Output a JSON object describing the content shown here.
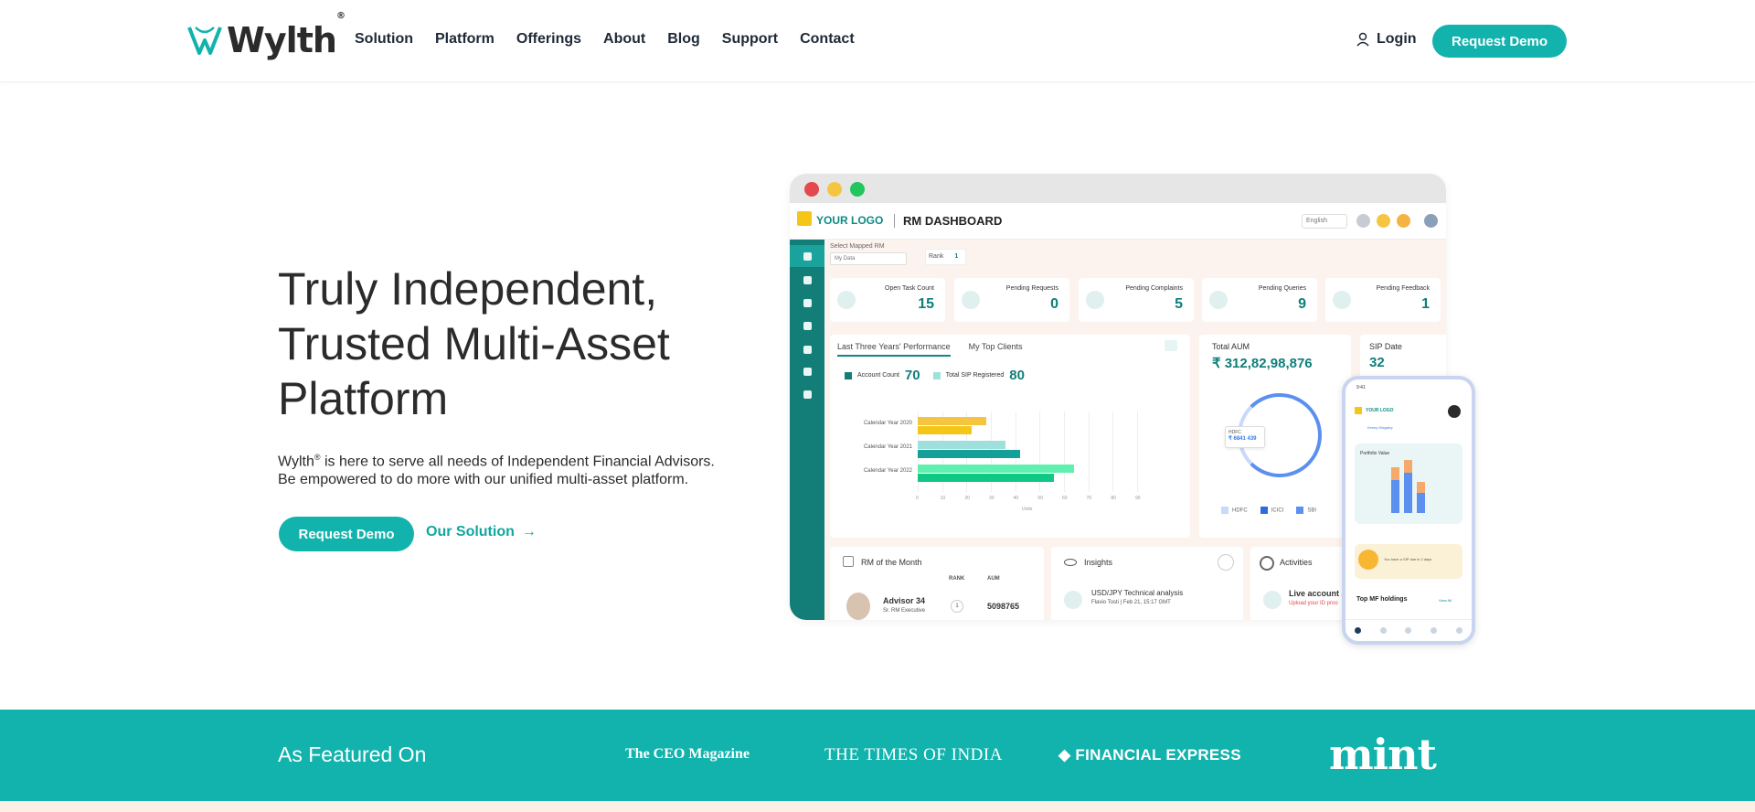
{
  "header": {
    "brand": "Wylth",
    "brand_reg": "®",
    "nav": [
      "Solution",
      "Platform",
      "Offerings",
      "About",
      "Blog",
      "Support",
      "Contact"
    ],
    "login_label": "Login",
    "login_icon": "user-icon",
    "demo_label": "Request Demo"
  },
  "hero": {
    "title_line1": "Truly Independent,",
    "title_line2": "Trusted Multi-Asset",
    "title_line3": "Platform",
    "sub_brand": "Wylth",
    "sub_reg": "®",
    "sub_line1_rest": " is here to serve all needs of Independent Financial Advisors.",
    "sub_line2": "Be empowered to do more with our unified multi-asset platform.",
    "demo_label": "Request Demo",
    "solution_label": "Our Solution",
    "solution_arrow": "→"
  },
  "dashboard": {
    "logo_text": "YOUR LOGO",
    "title": "RM DASHBOARD",
    "language": "English",
    "select_label": "Select Mapped RM",
    "select_value": "My Data",
    "rank_label": "Rank",
    "rank_value": "1",
    "kpis": [
      {
        "label": "Open Task Count",
        "value": "15"
      },
      {
        "label": "Pending Requests",
        "value": "0"
      },
      {
        "label": "Pending Complaints",
        "value": "5"
      },
      {
        "label": "Pending Queries",
        "value": "9"
      },
      {
        "label": "Pending Feedback",
        "value": "1"
      }
    ],
    "perf_tabs": [
      "Last Three Years' Performance",
      "My Top Clients"
    ],
    "account_count_label": "Account Count",
    "account_count_value": "70",
    "sip_registered_label": "Total SIP Registered",
    "sip_registered_value": "80",
    "chart_data": {
      "type": "bar",
      "orientation": "horizontal",
      "categories": [
        "Calendar Year 2020",
        "Calendar Year 2021",
        "Calendar Year 2022"
      ],
      "series": [
        {
          "name": "Account Count",
          "values": [
            28,
            36,
            64
          ],
          "color": "#f5c518"
        },
        {
          "name": "Total SIP Registered",
          "values": [
            22,
            42,
            56
          ],
          "color": "#f5c518"
        }
      ],
      "series_colors": [
        [
          "#f5c542",
          "#f5c518"
        ],
        [
          "#9fe0dc",
          "#14a098"
        ],
        [
          "#5ff0b0",
          "#10c784"
        ]
      ],
      "xticks": [
        "0",
        "10",
        "20",
        "30",
        "40",
        "50",
        "60",
        "70",
        "80",
        "90"
      ],
      "xlabel": "Units",
      "xlim": [
        0,
        90
      ]
    },
    "aum_label": "Total AUM",
    "aum_value": "₹ 312,82,98,876",
    "aum_tooltip_label": "HDFC",
    "aum_tooltip_value": "₹ 6841 439",
    "aum_legend": [
      "HDFC",
      "ICICI",
      "SBI"
    ],
    "sip_date_label": "SIP Date",
    "sip_date_value": "32",
    "rm_month_label": "RM of the Month",
    "rank_col": "RANK",
    "aum_col": "AUM",
    "advisor_name": "Advisor 34",
    "advisor_role": "Sr. RM Executive",
    "advisor_rank": "1",
    "advisor_aum": "5098765",
    "insights_label": "Insights",
    "insight_title": "USD/JPY Technical analysis",
    "insight_sub": "Flavio Tosti | Feb 21, 15:17 GMT",
    "activities_label": "Activities",
    "activity_title": "Live account a",
    "activity_sub": "Upload your ID proo"
  },
  "phone": {
    "time": "9:41",
    "logo_text": "YOUR LOGO",
    "user_name": "Kenny Kingsley",
    "portfolio_label": "Portfolio Value",
    "holdings_label": "Top MF holdings",
    "view_all": "View All",
    "promo_text": "You have a SIP due in 2 days"
  },
  "featured": {
    "label": "As Featured On",
    "logos": [
      "The CEO Magazine",
      "THE TIMES OF INDIA",
      "FINANCIAL EXPRESS",
      "mint"
    ]
  },
  "colors": {
    "accent": "#12b3ad",
    "dark_teal": "#137d78",
    "text_dark": "#2b2b2b"
  }
}
